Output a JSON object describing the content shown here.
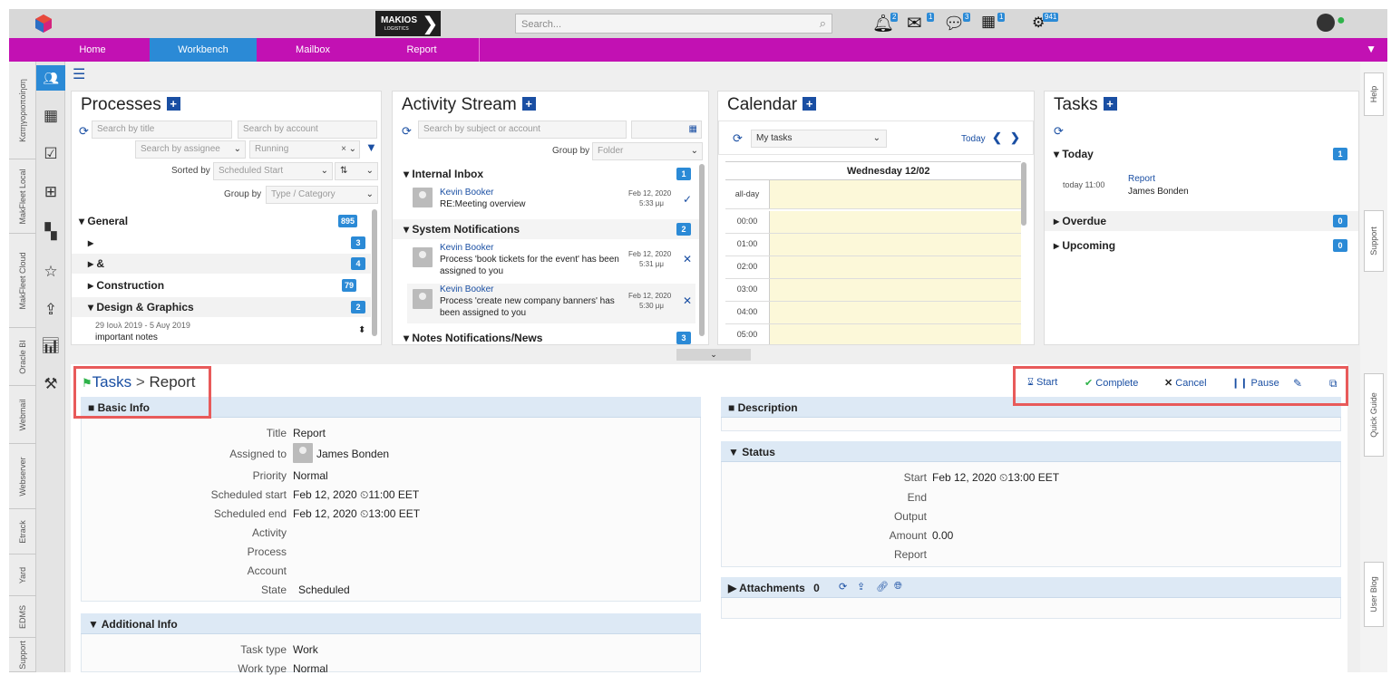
{
  "topbar": {
    "logo_text": "MAKIOS",
    "logo_sub": "LOGISTICS",
    "search_placeholder": "Search...",
    "notifications": {
      "bell": "2",
      "mail": "1",
      "chat": "3",
      "calendar": "1",
      "tasks": "941"
    }
  },
  "nav": [
    "Home",
    "Workbench",
    "Mailbox",
    "Report"
  ],
  "left_tabs": [
    "Κατηγοριοποίηση",
    "MakFleet Local",
    "MakFleet Cloud",
    "Oracle BI",
    "Webmail",
    "Webserver",
    "Etrack",
    "Yard",
    "EDMS",
    "Support"
  ],
  "right_tabs": [
    "Help",
    "Support",
    "Quick Guide",
    "User Blog"
  ],
  "processes": {
    "title": "Processes",
    "search_title": "Search by title",
    "search_account": "Search by account",
    "search_assignee": "Search by assignee",
    "status": "Running",
    "sorted_label": "Sorted by",
    "sorted_value": "Scheduled Start",
    "group_label": "Group by",
    "group_value": "Type / Category",
    "items": [
      {
        "label": "General",
        "count": "895"
      },
      {
        "label": "",
        "count": "3"
      },
      {
        "label": "&",
        "count": "4"
      },
      {
        "label": "Construction",
        "count": "79"
      },
      {
        "label": "Design & Graphics",
        "count": "2"
      }
    ],
    "sub_dates": "29 Ιουλ 2019 - 5 Αυγ 2019",
    "sub_title": "important notes"
  },
  "activity": {
    "title": "Activity Stream",
    "search_placeholder": "Search by subject or account",
    "group_label": "Group by",
    "group_value": "Folder",
    "sections": [
      {
        "label": "Internal Inbox",
        "count": "1"
      },
      {
        "label": "System Notifications",
        "count": "2"
      },
      {
        "label": "Notes Notifications/News",
        "count": "3"
      }
    ],
    "items": [
      {
        "author": "Kevin Booker",
        "text": "RE:Meeting overview",
        "date": "Feb 12, 2020",
        "time": "5:33 μμ"
      },
      {
        "author": "Kevin Booker",
        "text": "Process 'book tickets for the event' has been assigned to you",
        "date": "Feb 12, 2020",
        "time": "5:31 μμ"
      },
      {
        "author": "Kevin Booker",
        "text": "Process 'create new company banners' has been assigned to you",
        "date": "Feb 12, 2020",
        "time": "5:30 μμ"
      }
    ]
  },
  "calendar": {
    "title": "Calendar",
    "select": "My tasks",
    "today": "Today",
    "day_header": "Wednesday 12/02",
    "allday": "all-day",
    "hours": [
      "00:00",
      "01:00",
      "02:00",
      "03:00",
      "04:00",
      "05:00"
    ]
  },
  "tasks_widget": {
    "title": "Tasks",
    "today_label": "Today",
    "today_count": "1",
    "task_time": "today 11:00",
    "task_title": "Report",
    "task_person": "James Bonden",
    "overdue_label": "Overdue",
    "overdue_count": "0",
    "upcoming_label": "Upcoming",
    "upcoming_count": "0"
  },
  "detail": {
    "breadcrumb_root": "Tasks",
    "breadcrumb_current": "Report",
    "actions": {
      "start": "Start",
      "complete": "Complete",
      "cancel": "Cancel",
      "pause": "Pause"
    },
    "basic_info": {
      "header": "Basic Info",
      "title_label": "Title",
      "title": "Report",
      "assigned_label": "Assigned to",
      "assigned": "James Bonden",
      "priority_label": "Priority",
      "priority": "Normal",
      "sched_start_label": "Scheduled start",
      "sched_start": "Feb 12, 2020 ⏲11:00 EET",
      "sched_end_label": "Scheduled end",
      "sched_end": "Feb 12, 2020 ⏲13:00 EET",
      "activity_label": "Activity",
      "process_label": "Process",
      "account_label": "Account",
      "state_label": "State",
      "state": "Scheduled"
    },
    "additional_info": {
      "header": "Additional Info",
      "task_type_label": "Task type",
      "task_type": "Work",
      "work_type_label": "Work type",
      "work_type": "Normal"
    },
    "description_header": "Description",
    "status": {
      "header": "Status",
      "start_label": "Start",
      "start": "Feb 12, 2020 ⏲13:00 EET",
      "end_label": "End",
      "output_label": "Output",
      "amount_label": "Amount",
      "amount": "0.00",
      "report_label": "Report"
    },
    "attachments": {
      "header": "Attachments",
      "count": "0"
    }
  }
}
